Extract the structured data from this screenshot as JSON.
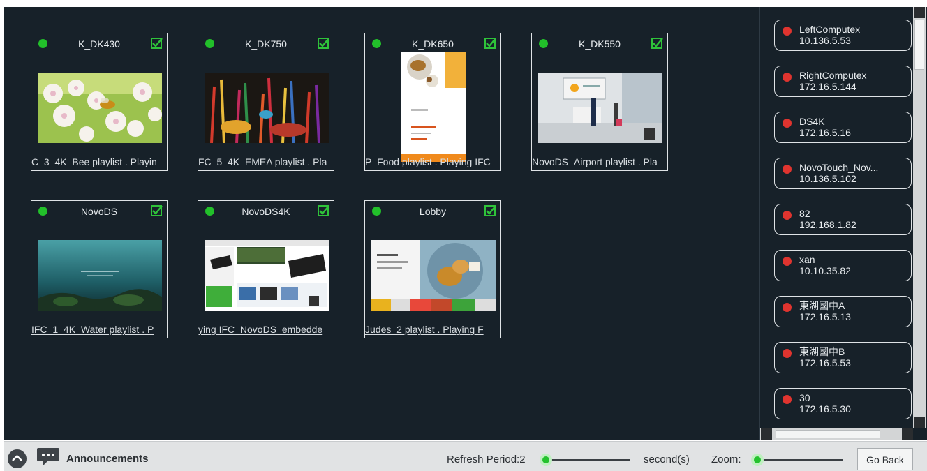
{
  "tiles": [
    {
      "name": "K_DK430",
      "caption": "C_3_4K_Bee playlist . Playin"
    },
    {
      "name": "K_DK750",
      "caption": "FC_5_4K_EMEA playlist . Pla"
    },
    {
      "name": "K_DK650",
      "caption": "P_Food playlist . Playing IFC"
    },
    {
      "name": "K_DK550",
      "caption": "NovoDS_Airport playlist . Pla"
    },
    {
      "name": "NovoDS",
      "caption": "IFC_1_4K_Water playlist . P"
    },
    {
      "name": "NovoDS4K",
      "caption": "ying IFC_NovoDS_embedde"
    },
    {
      "name": "Lobby",
      "caption": "Judes_2 playlist . Playing F"
    }
  ],
  "devices": [
    {
      "name": "LeftComputex",
      "ip": "10.136.5.53"
    },
    {
      "name": "RightComputex",
      "ip": "172.16.5.144"
    },
    {
      "name": "DS4K",
      "ip": "172.16.5.16"
    },
    {
      "name": "NovoTouch_Nov...",
      "ip": "10.136.5.102"
    },
    {
      "name": "82",
      "ip": "192.168.1.82"
    },
    {
      "name": "xan",
      "ip": "10.10.35.82"
    },
    {
      "name": "東湖國中A",
      "ip": "172.16.5.13"
    },
    {
      "name": "東湖國中B",
      "ip": "172.16.5.53"
    },
    {
      "name": "30",
      "ip": "172.16.5.30"
    }
  ],
  "bottom": {
    "announcements": "Announcements",
    "refresh_label": "Refresh Period:2",
    "unit_label": "second(s)",
    "zoom_label": "Zoom:",
    "go_back": "Go Back"
  },
  "colors": {
    "panel_bg": "#172129",
    "online": "#22c02a",
    "offline": "#e0342f",
    "checkbox": "#2fc33a"
  }
}
